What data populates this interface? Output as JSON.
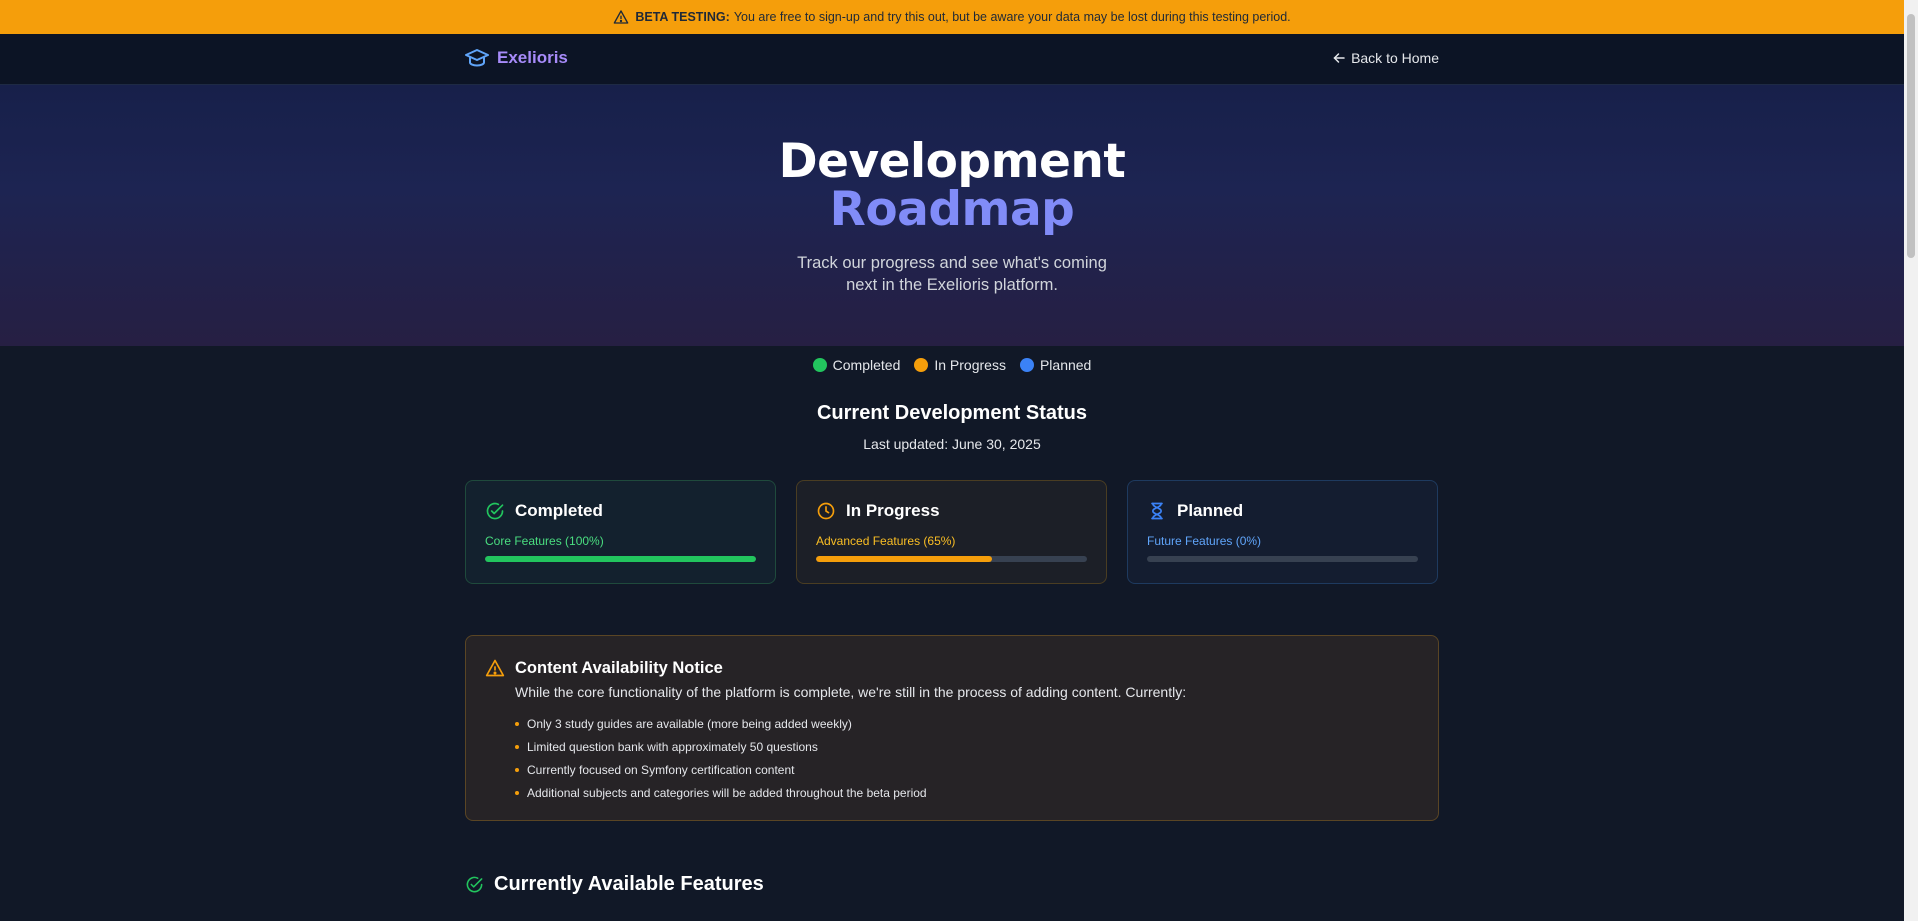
{
  "banner": {
    "label": "BETA TESTING:",
    "text": "You are free to sign-up and try this out, but be aware your data may be lost during this testing period.",
    "icon": "warning-triangle-icon"
  },
  "nav": {
    "brand": "Exelioris",
    "brand_icon": "graduation-cap-icon",
    "back_label": "Back to Home",
    "back_icon": "arrow-left-icon"
  },
  "hero": {
    "title_line1": "Development",
    "title_line2": "Roadmap",
    "subtitle": "Track our progress and see what's coming next in the Exelioris platform."
  },
  "legend": [
    {
      "label": "Completed",
      "color": "#22c55e"
    },
    {
      "label": "In Progress",
      "color": "#f59e0b"
    },
    {
      "label": "Planned",
      "color": "#3b82f6"
    }
  ],
  "status": {
    "title": "Current Development Status",
    "updated": "Last updated: June 30, 2025"
  },
  "cards": [
    {
      "title": "Completed",
      "subtitle": "Core Features (100%)",
      "progress": 1.0,
      "color": "#22c55e",
      "icon": "check-circle-icon"
    },
    {
      "title": "In Progress",
      "subtitle": "Advanced Features (65%)",
      "progress": 0.65,
      "color": "#f59e0b",
      "icon": "clock-icon"
    },
    {
      "title": "Planned",
      "subtitle": "Future Features (0%)",
      "progress": 0.0,
      "color": "#3b82f6",
      "icon": "hourglass-icon"
    }
  ],
  "notice": {
    "title": "Content Availability Notice",
    "text": "While the core functionality of the platform is complete, we're still in the process of adding content. Currently:",
    "items": [
      "Only 3 study guides are available (more being added weekly)",
      "Limited question bank with approximately 50 questions",
      "Currently focused on Symfony certification content",
      "Additional subjects and categories will be added throughout the beta period"
    ],
    "color": "#f59e0b"
  },
  "features": {
    "title": "Currently Available Features",
    "icon": "check-circle-icon"
  }
}
